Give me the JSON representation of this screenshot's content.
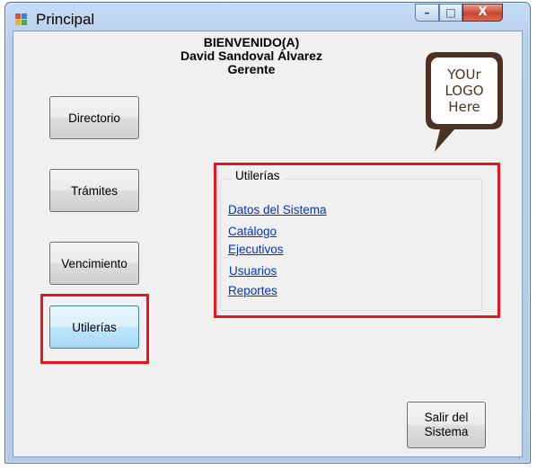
{
  "window": {
    "title": "Principal",
    "controls": {
      "minimize": "–",
      "maximize": "□",
      "close": "X"
    }
  },
  "welcome": {
    "line1": "BIENVENIDO(A)",
    "line2": "David Sandoval Álvarez",
    "line3": "Gerente"
  },
  "logo": {
    "line1": "YOUr",
    "line2": "LOGO",
    "line3": "Here"
  },
  "nav_buttons": {
    "directorio": "Directorio",
    "tramites": "Trámites",
    "vencimiento": "Vencimiento",
    "utilerias": "Utilerías"
  },
  "utilerias_group": {
    "title": "Utilerías",
    "links": [
      "Datos del Sistema",
      "Catálogo",
      "Ejecutivos",
      "Usuarios",
      "Reportes"
    ]
  },
  "exit_button": {
    "line1": "Salir del",
    "line2": "Sistema"
  },
  "colors": {
    "highlight_red": "#e8151d",
    "logo_brown": "#4a3323",
    "link_blue": "#0033cc"
  }
}
